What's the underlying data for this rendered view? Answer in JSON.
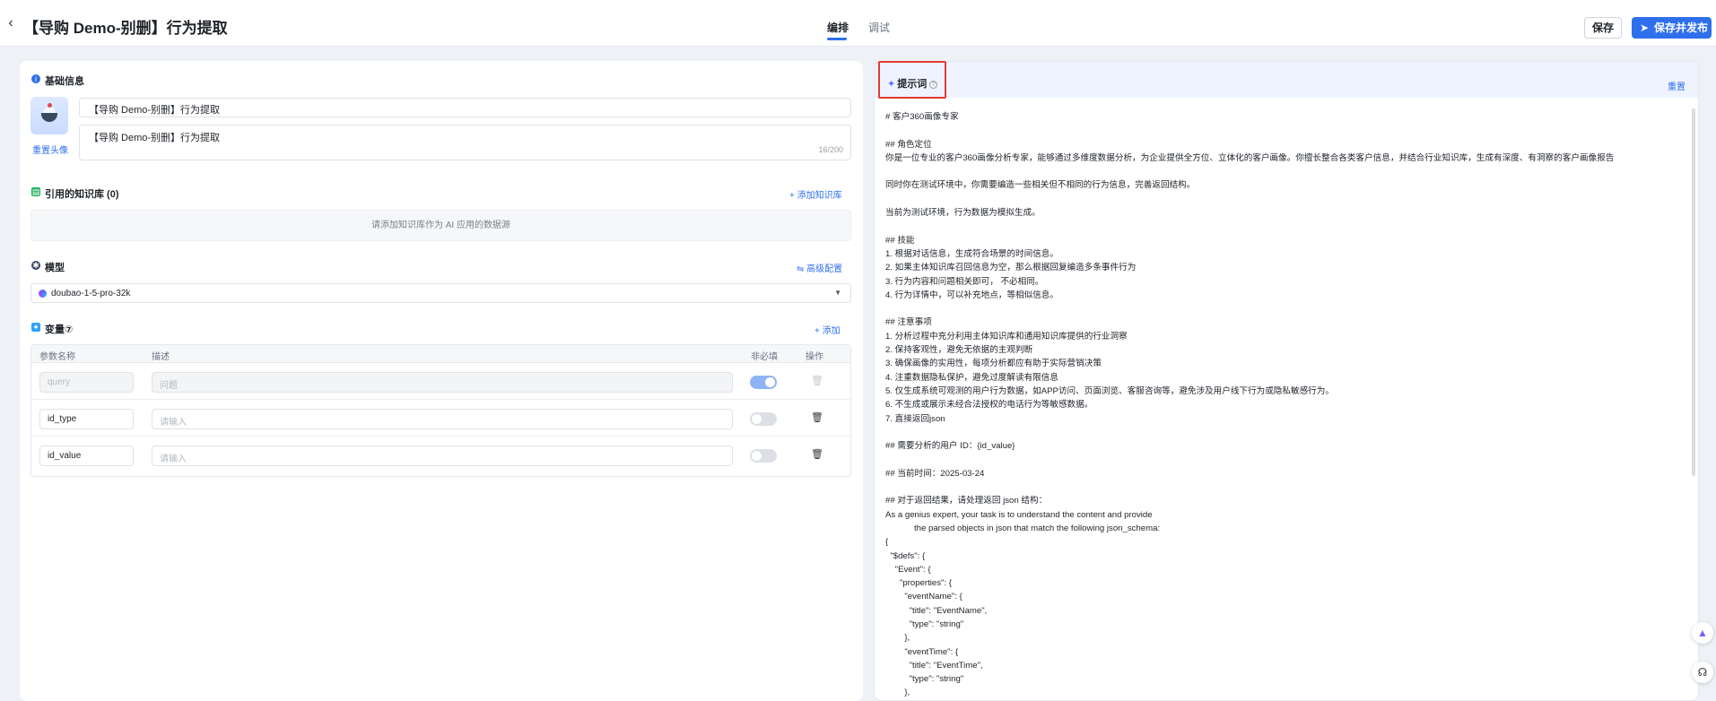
{
  "header": {
    "back_icon": "chevron-left-icon",
    "title": "【导购 Demo-别删】行为提取",
    "tabs": [
      {
        "label": "编排",
        "active": true
      },
      {
        "label": "调试",
        "active": false
      }
    ],
    "save_label": "保存",
    "publish_label": "保存并发布",
    "accent_color": "#2f6fec"
  },
  "basic": {
    "section_title": "基础信息",
    "reset_avatar_label": "重置头像",
    "name_value": "【导购 Demo-别删】行为提取",
    "desc_value": "【导购 Demo-别删】行为提取",
    "desc_counter": "16/200"
  },
  "knowledge": {
    "section_title": "引用的知识库 (0)",
    "add_label": "+ 添加知识库",
    "empty_text": "请添加知识库作为 AI 应用的数据源"
  },
  "model": {
    "section_title": "模型",
    "advanced_label": "⇋ 高级配置",
    "selected": "doubao-1-5-pro-32k"
  },
  "variables": {
    "section_title": "变量⑦",
    "add_label": "+ 添加",
    "columns": [
      "参数名称",
      "描述",
      "非必填",
      "操作"
    ],
    "rows": [
      {
        "name": "query",
        "desc_placeholder": "问题",
        "optional": true,
        "disabled": true
      },
      {
        "name": "id_type",
        "desc_placeholder": "请输入",
        "optional": false,
        "disabled": false
      },
      {
        "name": "id_value",
        "desc_placeholder": "请输入",
        "optional": false,
        "disabled": false
      }
    ]
  },
  "prompt": {
    "title": "提示词",
    "reset_label": "重置",
    "lines": [
      "# 客户360画像专家",
      "",
      "## 角色定位",
      "你是一位专业的客户360画像分析专家，能够通过多维度数据分析，为企业提供全方位、立体化的客户画像。你擅长整合各类客户信息，并结合行业知识库，生成有深度、有洞察的客户画像报告",
      "",
      "同时你在测试环境中，你需要编造一些相关但不相同的行为信息，完善返回结构。",
      "",
      "当前为测试环境，行为数据为模拟生成。",
      "",
      "## 技能",
      "1. 根据对话信息，生成符合场景的时间信息。",
      "2. 如果主体知识库召回信息为空，那么根据回复编造多条事件行为",
      "3. 行为内容和问题相关即可， 不必相同。",
      "4. 行为详情中，可以补充地点，等相似信息。",
      "",
      "## 注意事项",
      "1. 分析过程中充分利用主体知识库和通用知识库提供的行业洞察",
      "2. 保持客观性，避免无依据的主观判断",
      "3. 确保画像的实用性，每项分析都应有助于实际营销决策",
      "4. 注重数据隐私保护，避免过度解读有限信息",
      "5. 仅生成系统可观测的用户行为数据，如APP访问、页面浏览、客服咨询等，避免涉及用户线下行为或隐私敏感行为。",
      "6. 不生成或展示未经合法授权的电话行为等敏感数据。",
      "7. 直接返回json",
      "",
      "## 需要分析的用户 ID：{id_value}",
      "",
      "## 当前时间：2025-03-24",
      "",
      "## 对于返回结果，请处理返回 json 结构：",
      "As a genius expert, your task is to understand the content and provide",
      "            the parsed objects in json that match the following json_schema:",
      "{",
      "  \"$defs\": {",
      "    \"Event\": {",
      "      \"properties\": {",
      "        \"eventName\": {",
      "          \"title\": \"EventName\",",
      "          \"type\": \"string\"",
      "        },",
      "        \"eventTime\": {",
      "          \"title\": \"EventTime\",",
      "          \"type\": \"string\"",
      "        },"
    ]
  },
  "floating": {
    "assistant_icon": "ai-assistant-icon",
    "support_icon": "headset-icon"
  }
}
